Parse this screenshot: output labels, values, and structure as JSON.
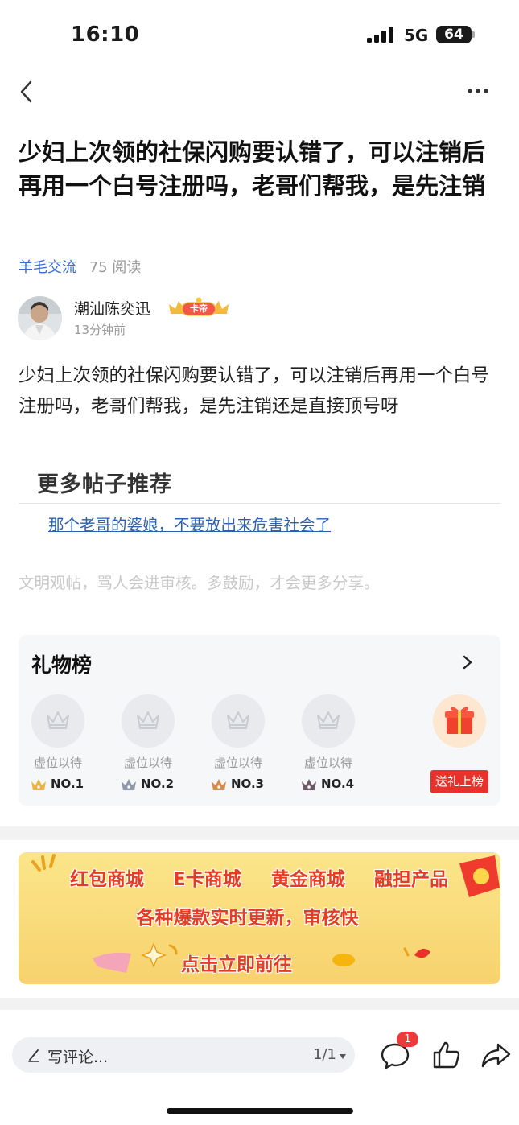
{
  "status_bar": {
    "time": "16:10",
    "network": "5G",
    "battery": "64"
  },
  "nav": {
    "back_icon": "chevron-left-icon",
    "more_icon": "more-dots-icon"
  },
  "post": {
    "title": "少妇上次领的社保闪购要认错了，可以注销后再用一个白号注册吗，老哥们帮我，是先注销",
    "channel": "羊毛交流",
    "reads": "75 阅读",
    "author": {
      "name": "潮汕陈奕迅",
      "badge": "卡帝",
      "time": "13分钟前"
    },
    "body": "少妇上次领的社保闪购要认错了，可以注销后再用一个白号注册吗，老哥们帮我，是先注销还是直接顶号呀"
  },
  "more_posts": {
    "heading": "更多帖子推荐",
    "items": [
      {
        "title": "那个老哥的婆娘，不要放出来危害社会了"
      }
    ]
  },
  "civility_note": "文明观帖，骂人会进审核。多鼓励，才会更多分享。",
  "gift_board": {
    "title": "礼物榜",
    "slots": [
      {
        "label": "虚位以待",
        "rank": "NO.1",
        "crown_color": "#e8b53a"
      },
      {
        "label": "虚位以待",
        "rank": "NO.2",
        "crown_color": "#8d97a8"
      },
      {
        "label": "虚位以待",
        "rank": "NO.3",
        "crown_color": "#d98a4a"
      },
      {
        "label": "虚位以待",
        "rank": "NO.4",
        "crown_color": "#6b5a66"
      }
    ],
    "send_label": "送礼上榜"
  },
  "banner": {
    "items": [
      "红包商城",
      "E卡商城",
      "黄金商城",
      "融担产品"
    ],
    "subtitle": "各种爆款实时更新，审核快",
    "cta": "点击立即前往"
  },
  "comment_bar": {
    "placeholder": "写评论...",
    "page": "1/1",
    "comment_count": "1"
  },
  "colors": {
    "accent_red": "#e7322b",
    "link_blue": "#2b5fb0",
    "channel_blue": "#3a6bd6",
    "banner_yellow": "#f9dc7b"
  }
}
